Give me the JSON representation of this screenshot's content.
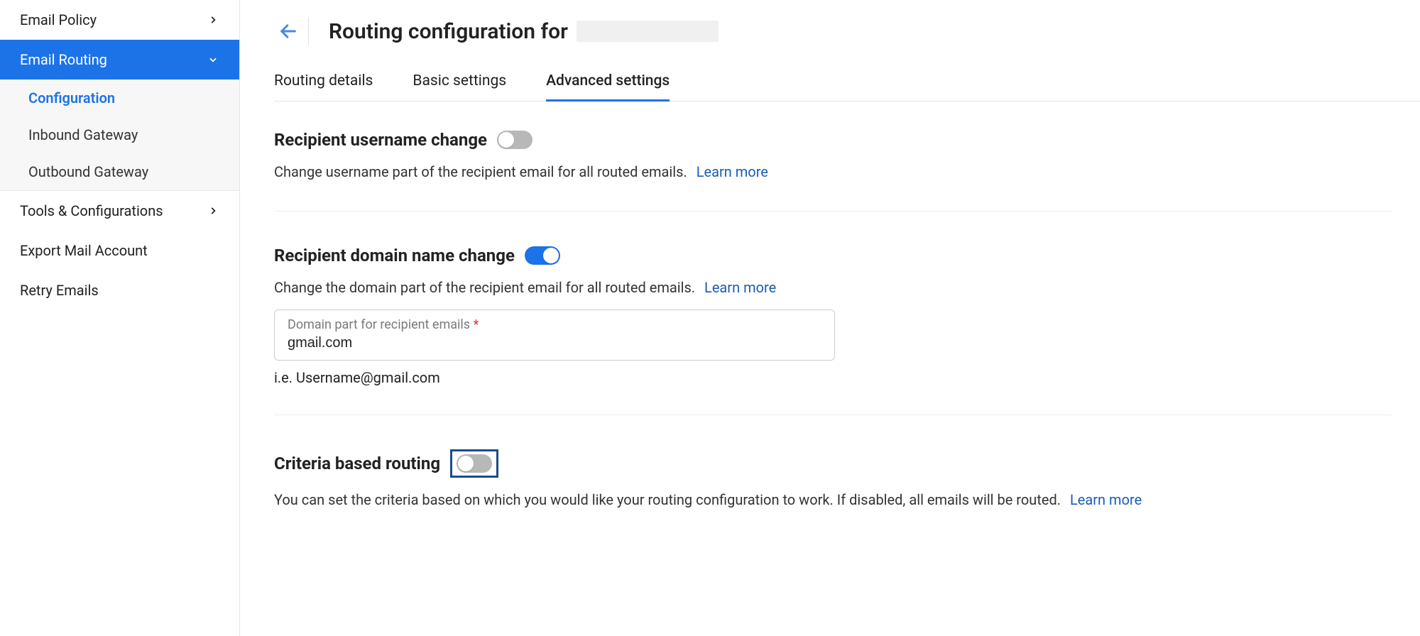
{
  "sidebar": {
    "email_policy": "Email Policy",
    "email_routing": "Email Routing",
    "subitems": {
      "configuration": "Configuration",
      "inbound_gateway": "Inbound Gateway",
      "outbound_gateway": "Outbound Gateway"
    },
    "tools_config": "Tools & Configurations",
    "export_mail": "Export Mail Account",
    "retry_emails": "Retry Emails"
  },
  "header": {
    "title": "Routing configuration for"
  },
  "tabs": {
    "routing_details": "Routing details",
    "basic_settings": "Basic settings",
    "advanced_settings": "Advanced settings"
  },
  "sections": {
    "username": {
      "title": "Recipient username change",
      "desc": "Change username part of the recipient email for all routed emails.",
      "learn_more": "Learn more",
      "toggle_on": false
    },
    "domain": {
      "title": "Recipient domain name change",
      "desc": "Change the domain part of the recipient email for all routed emails.",
      "learn_more": "Learn more",
      "toggle_on": true,
      "field_label": "Domain part for recipient emails",
      "field_value": "gmail.com",
      "hint": "i.e. Username@gmail.com"
    },
    "criteria": {
      "title": "Criteria based routing",
      "desc": "You can set the criteria based on which you would like your routing configuration to work. If disabled, all emails will be routed.",
      "learn_more": "Learn more",
      "toggle_on": false
    }
  }
}
